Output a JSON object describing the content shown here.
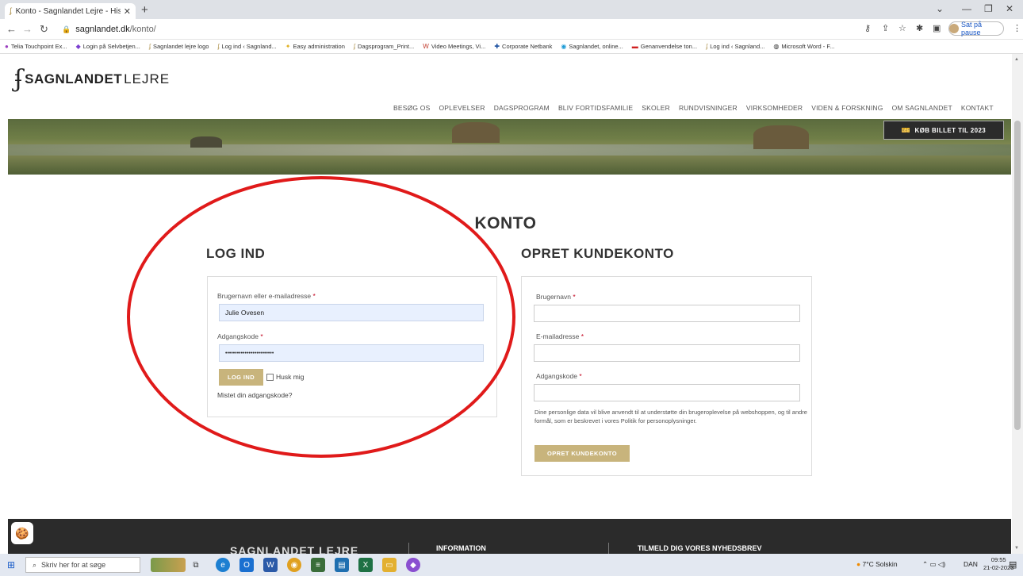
{
  "browser": {
    "tab_title": "Konto - Sagnlandet Lejre - Histo",
    "url_host": "sagnlandet.dk",
    "url_path": "/konto/",
    "pause_label": "Sat på pause",
    "bookmarks": [
      "Telia Touchpoint Ex...",
      "Login på Selvbetjen...",
      "Sagnlandet lejre logo",
      "Log ind ‹ Sagnland...",
      "Easy administration",
      "Dagsprogram_Print...",
      "Video Meetings, Vi...",
      "Corporate Netbank",
      "Sagnlandet, online...",
      "Genanvendelse ton...",
      "Log ind ‹ Sagnland...",
      "Microsoft Word - F..."
    ]
  },
  "site": {
    "logo_bold": "SAGNLANDET",
    "logo_light": "LEJRE",
    "nav": [
      "BESØG OS",
      "OPLEVELSER",
      "DAGSPROGRAM",
      "BLIV FORTIDSFAMILIE",
      "SKOLER",
      "RUNDVISNINGER",
      "VIRKSOMHEDER",
      "VIDEN & FORSKNING",
      "OM SAGNLANDET",
      "KONTAKT"
    ],
    "ticket_button": "KØB BILLET TIL 2023"
  },
  "page": {
    "title": "KONTO",
    "login": {
      "heading": "LOG IND",
      "username_label": "Brugernavn eller e-mailadresse",
      "username_value": "Julie Ovesen",
      "password_label": "Adgangskode",
      "password_value": "•••••••••••••••••••••••••",
      "submit": "LOG IND",
      "remember": "Husk mig",
      "lost_password": "Mistet din adgangskode?"
    },
    "register": {
      "heading": "OPRET KUNDEKONTO",
      "username_label": "Brugernavn",
      "email_label": "E-mailadresse",
      "password_label": "Adgangskode",
      "privacy_text": "Dine personlige data vil blive anvendt til at understøtte din brugeroplevelse på webshoppen, og til andre formål, som er beskrevet i vores Politik for personoplysninger.",
      "submit": "OPRET KUNDEKONTO"
    },
    "required_mark": "*"
  },
  "footer": {
    "logo": "SAGNLANDET LEJRE",
    "info_heading": "INFORMATION",
    "newsletter_heading": "TILMELD DIG VORES NYHEDSBREV"
  },
  "taskbar": {
    "search_placeholder": "Skriv her for at søge",
    "weather": "7°C Solskin",
    "language": "DAN",
    "time": "09:55",
    "date": "21-02-2023"
  },
  "colors": {
    "gold_button": "#c8b47c",
    "annotation_circle": "#e01a1a",
    "autofill_bg": "#e8f0fe",
    "required": "#c2001c"
  }
}
